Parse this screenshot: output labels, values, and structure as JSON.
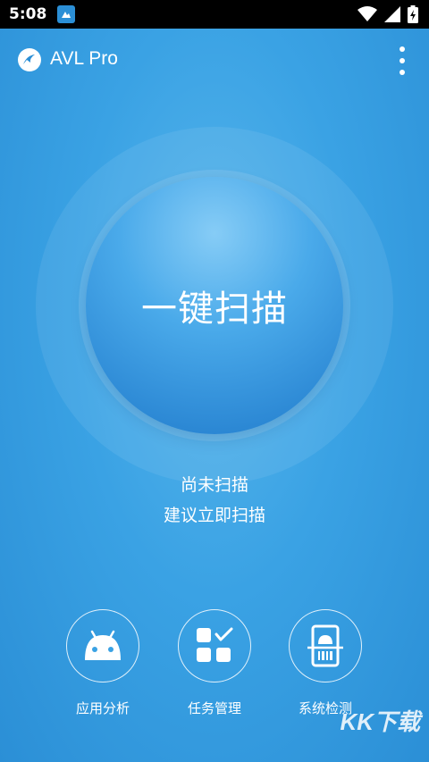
{
  "status_bar": {
    "time": "5:08",
    "app_icon": "avl-notification-icon",
    "icons": [
      "wifi-icon",
      "signal-icon",
      "battery-charging-icon"
    ]
  },
  "app_bar": {
    "title": "AVL Pro",
    "logo_icon": "avl-logo-icon",
    "menu_icon": "overflow-menu-icon"
  },
  "scan": {
    "button_label": "一键扫描",
    "status_line1": "尚未扫描",
    "status_line2": "建议立即扫描"
  },
  "tools": [
    {
      "label": "应用分析",
      "icon": "android-icon"
    },
    {
      "label": "任务管理",
      "icon": "task-grid-icon"
    },
    {
      "label": "系统检测",
      "icon": "phone-scan-icon"
    }
  ],
  "watermark": "KK下载",
  "colors": {
    "background": "#3aa2e4",
    "button": "#4aaaea",
    "text": "#ffffff"
  }
}
